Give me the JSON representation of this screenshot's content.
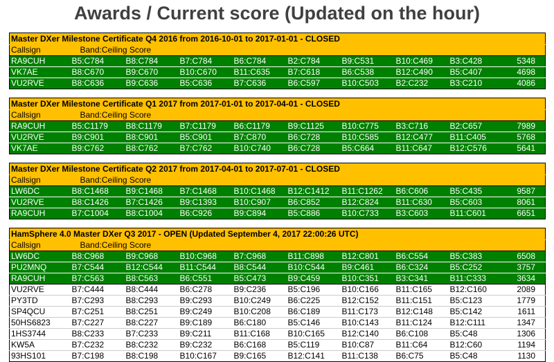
{
  "page": {
    "title": "Awards / Current score (Updated on the hour)"
  },
  "tables": [
    {
      "heading": "Master DXer Milestone Certificate Q4 2016 from 2016-10-01 to 2017-01-01 - CLOSED",
      "col_callsign": "Callsign",
      "col_band": "Band:Ceiling Score",
      "winners": 3,
      "rows": [
        [
          "RA9CUH",
          "B5:C784",
          "B8:C784",
          "B7:C784",
          "B6:C784",
          "B2:C784",
          "B9:C531",
          "B10:C469",
          "B3:C428",
          "5348"
        ],
        [
          "VK7AE",
          "B8:C670",
          "B9:C670",
          "B10:C670",
          "B11:C635",
          "B7:C618",
          "B6:C538",
          "B12:C490",
          "B5:C407",
          "4698"
        ],
        [
          "VU2RVE",
          "B8:C636",
          "B9:C636",
          "B5:C636",
          "B7:C636",
          "B6:C597",
          "B10:C503",
          "B2:C232",
          "B3:C210",
          "4086"
        ]
      ]
    },
    {
      "heading": "Master DXer Milestone Certificate Q1 2017 from 2017-01-01 to 2017-04-01 - CLOSED",
      "col_callsign": "Callsign",
      "col_band": "Band:Ceiling Score",
      "winners": 3,
      "rows": [
        [
          "RA9CUH",
          "B5:C1179",
          "B8:C1179",
          "B7:C1179",
          "B6:C1179",
          "B9:C1125",
          "B10:C775",
          "B3:C716",
          "B2:C657",
          "7989"
        ],
        [
          "VU2RVE",
          "B9:C901",
          "B8:C901",
          "B5:C901",
          "B7:C870",
          "B6:C728",
          "B10:C585",
          "B12:C477",
          "B11:C405",
          "5768"
        ],
        [
          "VK7AE",
          "B9:C762",
          "B8:C762",
          "B7:C762",
          "B10:C740",
          "B6:C728",
          "B5:C664",
          "B11:C647",
          "B12:C576",
          "5641"
        ]
      ]
    },
    {
      "heading": "Master DXer Milestone Certificate Q2 2017 from 2017-04-01 to 2017-07-01 - CLOSED",
      "col_callsign": "Callsign",
      "col_band": "Band:Ceiling Score",
      "winners": 3,
      "rows": [
        [
          "LW6DC",
          "B8:C1468",
          "B9:C1468",
          "B7:C1468",
          "B10:C1468",
          "B12:C1412",
          "B11:C1262",
          "B6:C606",
          "B5:C435",
          "9587"
        ],
        [
          "VU2RVE",
          "B8:C1426",
          "B7:C1426",
          "B9:C1393",
          "B10:C907",
          "B6:C852",
          "B12:C824",
          "B11:C630",
          "B5:C603",
          "8061"
        ],
        [
          "RA9CUH",
          "B7:C1004",
          "B8:C1004",
          "B6:C926",
          "B9:C894",
          "B5:C886",
          "B10:C733",
          "B3:C603",
          "B11:C601",
          "6651"
        ]
      ]
    },
    {
      "heading": "HamSphere 4.0 Master DXer Q3 2017 - OPEN (Updated September 4, 2017 22:00:26 UTC)",
      "col_callsign": "Callsign",
      "col_band": "Band:Ceiling Score",
      "winners": 3,
      "rows": [
        [
          "LW6DC",
          "B8:C968",
          "B9:C968",
          "B10:C968",
          "B7:C968",
          "B11:C898",
          "B12:C801",
          "B6:C554",
          "B5:C383",
          "6508"
        ],
        [
          "PU2MNQ",
          "B7:C544",
          "B12:C544",
          "B11:C544",
          "B8:C544",
          "B10:C544",
          "B9:C461",
          "B6:C324",
          "B5:C252",
          "3757"
        ],
        [
          "RA9CUH",
          "B7:C563",
          "B8:C563",
          "B6:C551",
          "B5:C473",
          "B9:C459",
          "B10:C351",
          "B3:C341",
          "B11:C333",
          "3634"
        ],
        [
          "VU2RVE",
          "B7:C444",
          "B8:C444",
          "B6:C278",
          "B9:C236",
          "B5:C196",
          "B10:C166",
          "B11:C165",
          "B12:C160",
          "2089"
        ],
        [
          "PY3TD",
          "B7:C293",
          "B8:C293",
          "B9:C293",
          "B10:C249",
          "B6:C225",
          "B12:C152",
          "B11:C151",
          "B5:C123",
          "1779"
        ],
        [
          "SP4QCU",
          "B7:C251",
          "B8:C251",
          "B9:C249",
          "B10:C208",
          "B6:C189",
          "B11:C173",
          "B12:C148",
          "B5:C142",
          "1611"
        ],
        [
          "50HS6823",
          "B7:C227",
          "B8:C227",
          "B9:C189",
          "B6:C180",
          "B5:C146",
          "B10:C143",
          "B11:C124",
          "B12:C111",
          "1347"
        ],
        [
          "1HS3744",
          "B8:C233",
          "B7:C233",
          "B9:C211",
          "B11:C168",
          "B10:C165",
          "B12:C140",
          "B6:C108",
          "B5:C48",
          "1306"
        ],
        [
          "KW5A",
          "B7:C232",
          "B8:C232",
          "B9:C232",
          "B6:C168",
          "B5:C119",
          "B10:C87",
          "B11:C64",
          "B12:C60",
          "1194"
        ],
        [
          "93HS101",
          "B7:C198",
          "B8:C198",
          "B10:C167",
          "B9:C165",
          "B12:C141",
          "B11:C138",
          "B6:C75",
          "B5:C48",
          "1130"
        ]
      ]
    }
  ],
  "colors": {
    "header_bg": "#ffc000",
    "winner_bg": "#008000",
    "winner_text": "#ffffff",
    "title_text": "#404040"
  }
}
